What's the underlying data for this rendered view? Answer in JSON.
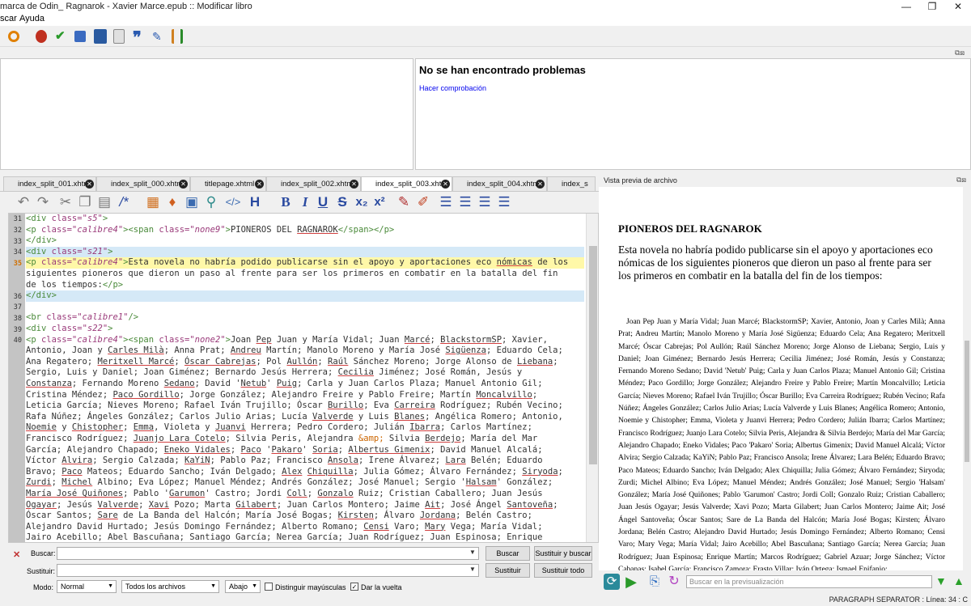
{
  "window": {
    "title": "marca de Odin_ Ragnarok - Xavier Marce.epub :: Modificar libro",
    "minimize": "—",
    "maximize": "❐",
    "close": "✕"
  },
  "menubar": {
    "items": [
      "scar",
      "Ayuda"
    ]
  },
  "toolbar": {
    "icons": [
      "resize-icon",
      "bug-icon",
      "spellcheck-icon",
      "tree-icon",
      "dictionary-icon",
      "report-icon",
      "quote-icon",
      "pencil-icon",
      "stats-icon"
    ]
  },
  "checker": {
    "title": "No se han encontrado problemas",
    "link": "Hacer comprobación"
  },
  "tabs": [
    {
      "label": "index_split_001.xhtml",
      "active": false
    },
    {
      "label": "index_split_000.xhtml",
      "active": false
    },
    {
      "label": "titlepage.xhtml",
      "active": false
    },
    {
      "label": "index_split_002.xhtml",
      "active": false
    },
    {
      "label": "index_split_003.xhtml",
      "active": true
    },
    {
      "label": "index_split_004.xhtml",
      "active": false
    },
    {
      "label": "index_s",
      "active": false
    }
  ],
  "editor": {
    "line_numbers": [
      "31",
      "32",
      "33",
      "34",
      "35",
      "",
      "",
      "36",
      "37",
      "38",
      "39",
      "40"
    ],
    "bold_button": "B",
    "italic_button": "I",
    "underline_button": "U",
    "strike_button": "S",
    "sub_button": "x₂",
    "sup_button": "x²",
    "heading_button": "H"
  },
  "find": {
    "search_label": "Buscar:",
    "replace_label": "Sustituir:",
    "mode_label": "Modo:",
    "mode_value": "Normal",
    "scope_value": "Todos los archivos",
    "direction_value": "Abajo",
    "case_label": "Distinguir mayúsculas",
    "wrap_label": "Dar la vuelta",
    "find_button": "Buscar",
    "replace_find_button": "Sustituir y buscar",
    "replace_button": "Sustituir",
    "replace_all_button": "Sustituir todo"
  },
  "preview": {
    "header": "Vista previa de archivo",
    "title": "PIONEROS DEL RAGNAROK",
    "paragraph": "Esta novela no habría podido publicarse sin el apoyo y aportaciones eco nómicas de los siguientes pioneros que dieron un paso al frente para ser los primeros en combatir en la batalla del fin de los tiempos:",
    "names": "Joan Pep Juan y María Vidal; Juan Marcé; BlackstormSP; Xavier, Antonio, Joan y Carles Milà; Anna Prat; Andreu Martín; Manolo Moreno y María José Sigüenza; Eduardo Cela; Ana Regatero; Meritxell Marcé; Óscar Cabrejas; Pol Aullón; Raúl Sánchez Moreno; Jorge Alonso de Liebana; Sergio, Luis y Daniel; Joan Giménez; Bernardo Jesús Herrera; Cecilia Jiménez; José Román, Jesús y Constanza; Fernando Moreno Sedano; David 'Netub' Puig; Carla y Juan Carlos Plaza; Manuel Antonio Gil; Cristina Méndez; Paco Gordillo; Jorge González; Alejandro Freire y Pablo Freire; Martín Moncalvillo; Leticia García; Nieves Moreno; Rafael Iván Trujillo; Óscar Burillo; Eva Carreira Rodríguez; Rubén Vecino; Rafa Núñez; Ángeles González; Carlos Julio Arias; Lucía Valverde y Luis Blanes; Angélica Romero; Antonio, Noemie y Chistopher; Emma, Violeta y Juanvi Herrera; Pedro Cordero; Julián Ibarra; Carlos Martínez; Francisco Rodríguez; Juanjo Lara Cotelo; Silvia Peris, Alejandra & Silvia Berdejo; María del Mar García; Alejandro Chapado; Eneko Vidales; Paco 'Pakaro' Soria; Albertus Gimenix; David Manuel Alcalá; Víctor Alvira; Sergio Calzada; KaYiN; Pablo Paz; Francisco Ansola; Irene Álvarez; Lara Belén; Eduardo Bravo; Paco Mateos; Eduardo Sancho; Iván Delgado; Alex Chiquilla; Julia Gómez; Álvaro Fernández; Siryoda; Zurdi; Michel Albino; Eva López; Manuel Méndez; Andrés González; José Manuel; Sergio 'Halsam' González; María José Quiñones; Pablo 'Garumon' Castro; Jordi Coll; Gonzalo Ruiz; Cristian Caballero; Juan Jesús Ogayar; Jesús Valverde; Xavi Pozo; Marta Gilabert; Juan Carlos Montero; Jaime Ait; José Ángel Santoveña; Óscar Santos; Sare de La Banda del Halcón; María José Bogas; Kirsten; Álvaro Jordana; Belén Castro; Alejandro David Hurtado; Jesús Domingo Fernández; Alberto Romano; Censi Varo; Mary Vega; María Vidal; Jairo Acebillo; Abel Bascuñana; Santiago García; Nerea García; Juan Rodríguez; Juan Espinosa; Enrique Martín; Marcos Rodríguez; Gabriel Azuar; Jorge Sánchez; Víctor Cabanas; Isabel García; Francisco Zamora; Erasto Villar; Iván Ortega; Ismael Epifanio;",
    "search_placeholder": "Buscar en la previsualización"
  },
  "status": {
    "text": "PARAGRAPH SEPARATOR : Línea: 34 : C"
  },
  "colors": {
    "highlight_line": "#fff8a8",
    "highlight_block": "#d5e9f7",
    "tag": "#4a8a3a",
    "attribute": "#9a3a7a"
  }
}
